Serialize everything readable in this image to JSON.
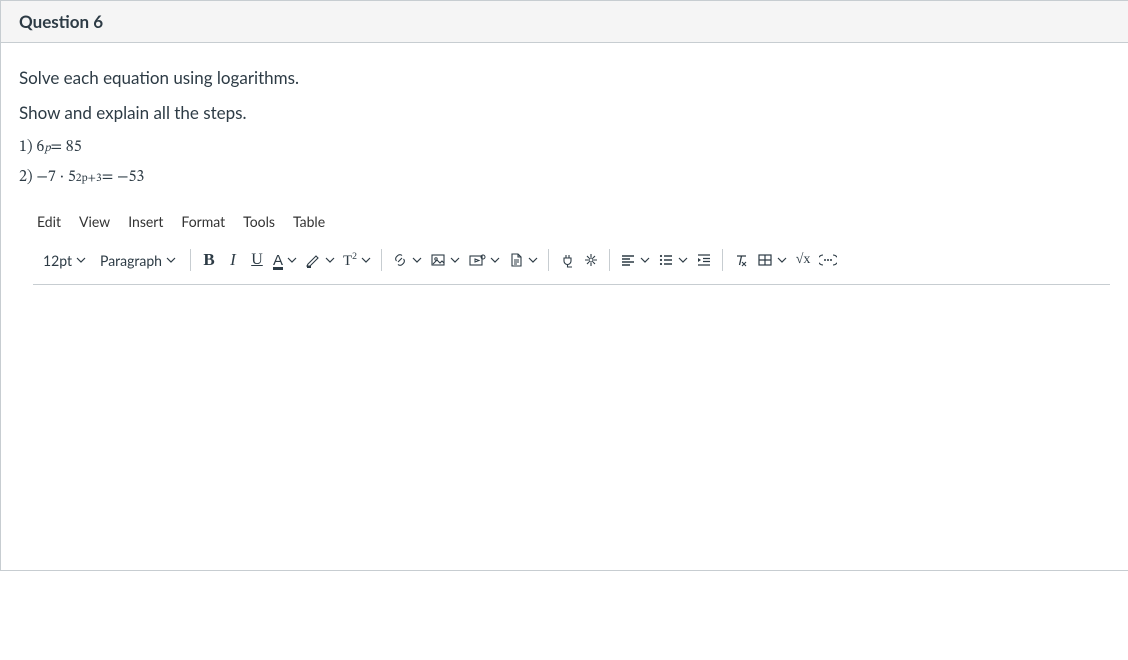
{
  "header": {
    "title": "Question 6"
  },
  "prompt": {
    "line1": "Solve each equation using  logarithms.",
    "line2": "Show and explain all the steps."
  },
  "equations": {
    "eq1_prefix": "1) 6",
    "eq1_exp": "p",
    "eq1_suffix": " = 85",
    "eq2_prefix": "2) −7 · 5",
    "eq2_exp": "2p+3",
    "eq2_suffix": " = −53"
  },
  "menubar": {
    "edit": "Edit",
    "view": "View",
    "insert": "Insert",
    "format": "Format",
    "tools": "Tools",
    "table": "Table"
  },
  "toolbar": {
    "fontsize": "12pt",
    "blockformat": "Paragraph",
    "bold": "B",
    "italic": "I",
    "underline": "U",
    "textcolor": "A",
    "superscript": "T",
    "superscript_exp": "2",
    "mathsqrt": "√x"
  }
}
